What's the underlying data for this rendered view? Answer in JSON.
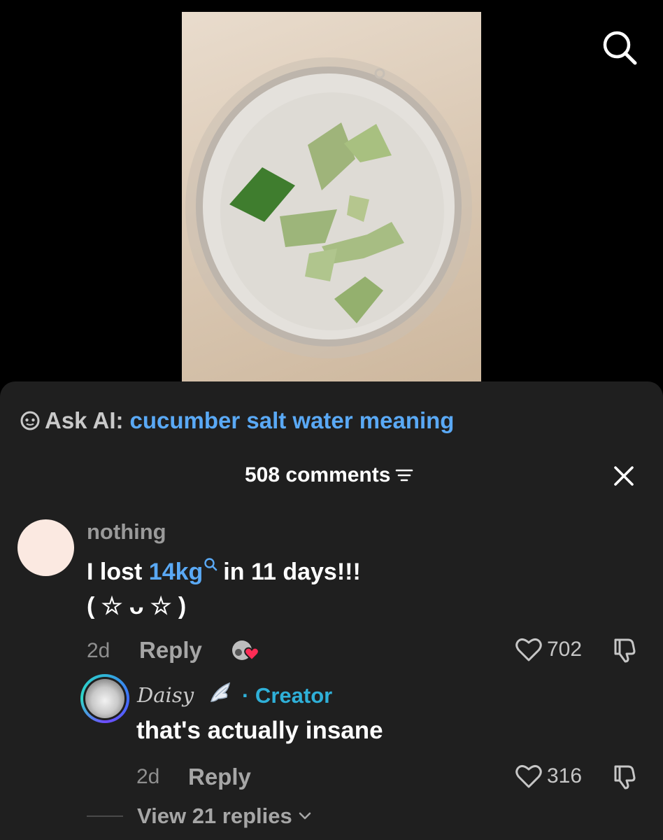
{
  "video": {
    "thumbnail": "cucumber-water-glass"
  },
  "search": {
    "icon": "search-icon"
  },
  "ask_ai": {
    "icon": "ai-bot-icon",
    "prefix": "Ask AI:",
    "query": "cucumber salt water meaning"
  },
  "comments_header": {
    "count_label": "508 comments",
    "sort_icon": "filter-icon",
    "close_icon": "close-icon"
  },
  "comment": {
    "username": "nothing",
    "text_before": "I lost",
    "keyword": "14kg",
    "text_after": "in 11 days!!!",
    "kaomoji": "( ☆ ᴗ ☆ )",
    "time": "2d",
    "reply_label": "Reply",
    "likes": "702",
    "creator_liked": true
  },
  "reply": {
    "username": "Daisy",
    "badge": "· Creator",
    "text": "that's actually insane",
    "time": "2d",
    "reply_label": "Reply",
    "likes": "316"
  },
  "view_replies": {
    "label": "View 21 replies"
  },
  "colors": {
    "accent_blue": "#5aa9f5",
    "creator_cyan": "#2fb0d8",
    "sheet_bg": "#1f1f1f",
    "heart_red": "#fe2c55"
  }
}
